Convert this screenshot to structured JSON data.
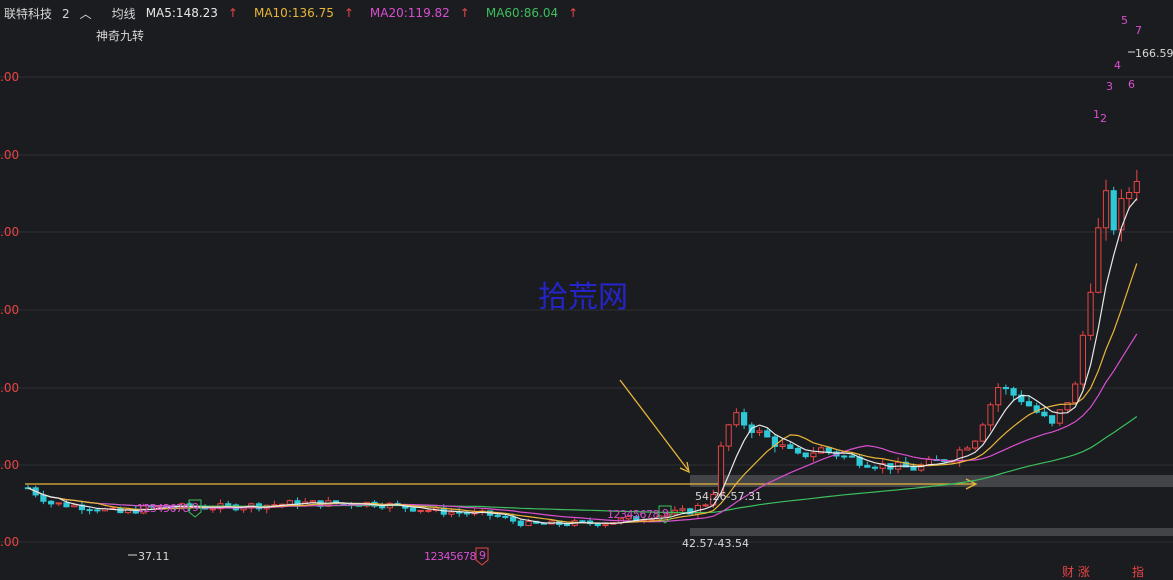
{
  "header": {
    "stock_name": "联特科技",
    "period": "2",
    "period_icon": "chevron-up-icon",
    "ma_label": "均线",
    "ma": [
      {
        "label": "MA5:148.23",
        "color": "#e8e8e8"
      },
      {
        "label": "MA10:136.75",
        "color": "#e8b53a"
      },
      {
        "label": "MA20:119.82",
        "color": "#d94fd0"
      },
      {
        "label": "MA60:86.04",
        "color": "#3cbf5c"
      }
    ],
    "arrow_icon": "up-arrow-icon"
  },
  "indicator_name": "神奇九转",
  "watermark": "拾荒网",
  "chart_data": {
    "type": "candlestick",
    "y_axis_labels": [
      ".00",
      ".00",
      ".00",
      ".00",
      ".00",
      ".00",
      ".00"
    ],
    "annotations": {
      "high": "166.59",
      "low": "37.11",
      "zone_upper": "54.26-57.31",
      "zone_lower": "42.57-43.54"
    },
    "sequences": [
      {
        "text": "12345678",
        "badge": "9",
        "badge_color": "#3cbf5c"
      },
      {
        "text": "12345678",
        "badge": "9",
        "badge_color": "#3cbf5c"
      },
      {
        "text": "12345678",
        "badge": "9",
        "badge_color": "#e84545"
      }
    ],
    "recent_counts": [
      "1",
      "2",
      "3",
      "4",
      "5",
      "6",
      "7"
    ],
    "colors": {
      "up": "#e84545",
      "down": "#2ec8d6",
      "ma5": "#e8e8e8",
      "ma10": "#e8b53a",
      "ma20": "#d94fd0",
      "ma60": "#3cbf5c"
    },
    "ma_trend": {
      "x": [
        0,
        8,
        15,
        22,
        28,
        31,
        33,
        36,
        37,
        40,
        42,
        45
      ],
      "ma5": [
        43,
        44,
        42,
        38,
        38,
        38,
        40,
        42,
        61,
        60,
        60,
        58,
        50,
        80,
        148
      ]
    },
    "grid": true
  },
  "footer": {
    "left": "财 涨",
    "right": "指"
  }
}
